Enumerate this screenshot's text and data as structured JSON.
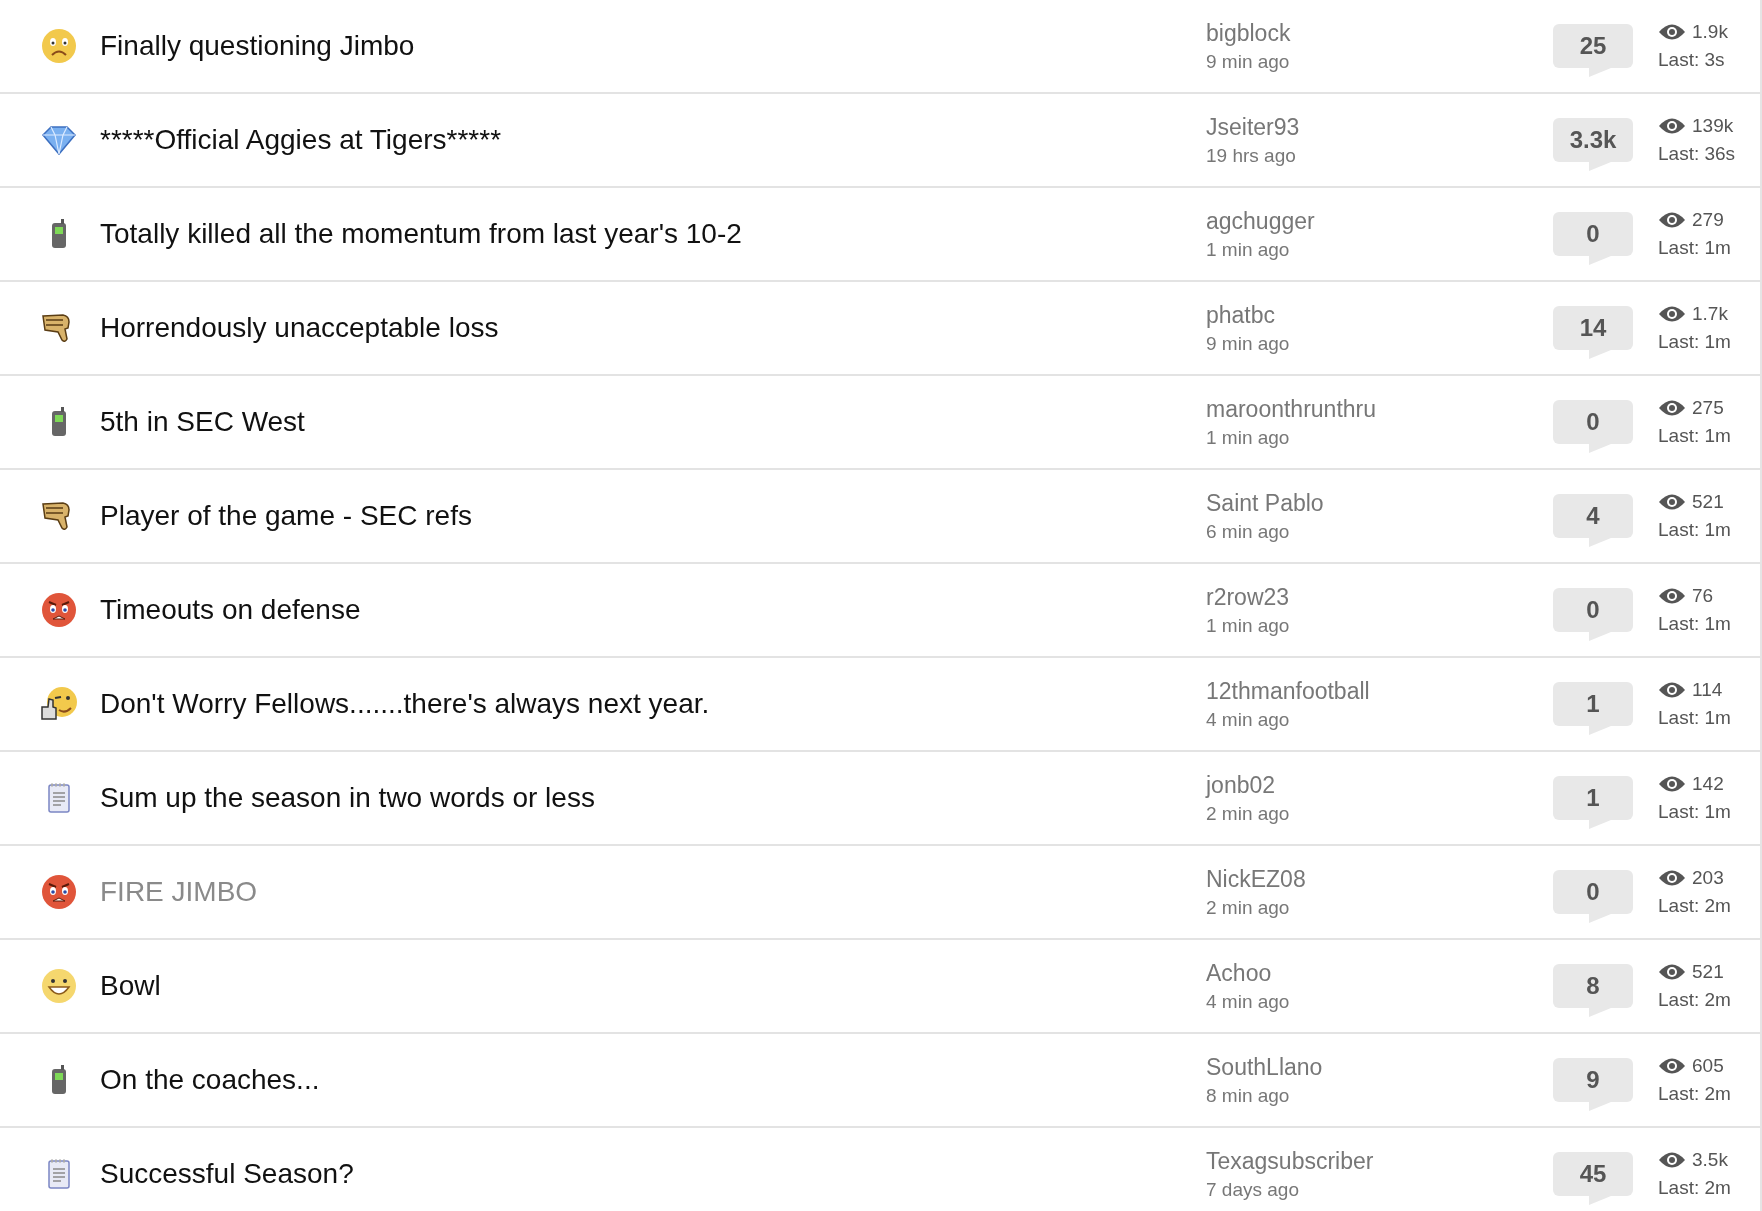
{
  "threads": [
    {
      "kind": "sad",
      "title": "Finally questioning Jimbo",
      "visited": false,
      "author": "bigblock",
      "age": "9 min ago",
      "replies": "25",
      "views": "1.9k",
      "last": "Last: 3s"
    },
    {
      "kind": "gem",
      "title": "*****Official Aggies at Tigers*****",
      "visited": false,
      "author": "Jseiter93",
      "age": "19 hrs ago",
      "replies": "3.3k",
      "views": "139k",
      "last": "Last: 36s"
    },
    {
      "kind": "phone",
      "title": "Totally killed all the momentum from last year's 10-2",
      "visited": false,
      "author": "agchugger",
      "age": "1 min ago",
      "replies": "0",
      "views": "279",
      "last": "Last: 1m"
    },
    {
      "kind": "thumbs-down",
      "title": "Horrendously unacceptable loss",
      "visited": false,
      "author": "phatbc",
      "age": "9 min ago",
      "replies": "14",
      "views": "1.7k",
      "last": "Last: 1m"
    },
    {
      "kind": "phone",
      "title": "5th in SEC West",
      "visited": false,
      "author": "maroonthrunthru",
      "age": "1 min ago",
      "replies": "0",
      "views": "275",
      "last": "Last: 1m"
    },
    {
      "kind": "thumbs-down",
      "title": "Player of the game - SEC refs",
      "visited": false,
      "author": "Saint Pablo",
      "age": "6 min ago",
      "replies": "4",
      "views": "521",
      "last": "Last: 1m"
    },
    {
      "kind": "angry",
      "title": "Timeouts on defense",
      "visited": false,
      "author": "r2row23",
      "age": "1 min ago",
      "replies": "0",
      "views": "76",
      "last": "Last: 1m"
    },
    {
      "kind": "wink-thumbs-up",
      "title": "Don't Worry Fellows.......there's always next year.",
      "visited": false,
      "author": "12thmanfootball",
      "age": "4 min ago",
      "replies": "1",
      "views": "114",
      "last": "Last: 1m"
    },
    {
      "kind": "notepad",
      "title": "Sum up the season in two words or less",
      "visited": false,
      "author": "jonb02",
      "age": "2 min ago",
      "replies": "1",
      "views": "142",
      "last": "Last: 1m"
    },
    {
      "kind": "angry",
      "title": "FIRE JIMBO",
      "visited": true,
      "author": "NickEZ08",
      "age": "2 min ago",
      "replies": "0",
      "views": "203",
      "last": "Last: 2m"
    },
    {
      "kind": "smile",
      "title": "Bowl",
      "visited": false,
      "author": "Achoo",
      "age": "4 min ago",
      "replies": "8",
      "views": "521",
      "last": "Last: 2m"
    },
    {
      "kind": "phone",
      "title": "On the coaches...",
      "visited": false,
      "author": "SouthLlano",
      "age": "8 min ago",
      "replies": "9",
      "views": "605",
      "last": "Last: 2m"
    },
    {
      "kind": "notepad",
      "title": "Successful Season?",
      "visited": false,
      "author": "Texagsubscriber",
      "age": "7 days ago",
      "replies": "45",
      "views": "3.5k",
      "last": "Last: 2m"
    }
  ]
}
